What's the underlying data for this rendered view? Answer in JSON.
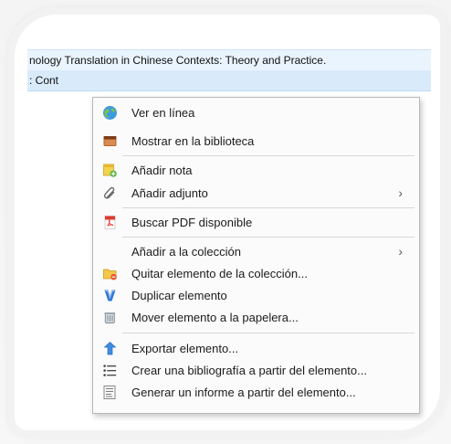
{
  "list": {
    "row1": "nology Translation in Chinese Contexts: Theory and Practice.",
    "row2": ": Cont"
  },
  "menu": {
    "items": [
      {
        "label": "Ver en línea",
        "icon": "globe-icon"
      },
      {
        "label": "Mostrar en la biblioteca",
        "icon": "library-icon"
      },
      {
        "label": "Añadir nota",
        "icon": "note-add-icon"
      },
      {
        "label": "Añadir adjunto",
        "icon": "paperclip-icon",
        "submenu": "›"
      },
      {
        "label": "Buscar PDF disponible",
        "icon": "pdf-icon"
      },
      {
        "label": "Añadir a la colección",
        "icon": "",
        "submenu": "›"
      },
      {
        "label": "Quitar elemento de la colección...",
        "icon": "folder-remove-icon"
      },
      {
        "label": "Duplicar elemento",
        "icon": "duplicate-icon"
      },
      {
        "label": "Mover elemento a la papelera...",
        "icon": "trash-icon"
      },
      {
        "label": "Exportar elemento...",
        "icon": "export-icon"
      },
      {
        "label": "Crear una bibliografía a partir del elemento...",
        "icon": "bibliography-icon"
      },
      {
        "label": "Generar un informe a partir del elemento...",
        "icon": "report-icon"
      }
    ]
  },
  "colors": {
    "row_highlight": "#eaf4fe",
    "row_selected": "#d9ebfb",
    "menu_bg": "#fbfbfb"
  }
}
